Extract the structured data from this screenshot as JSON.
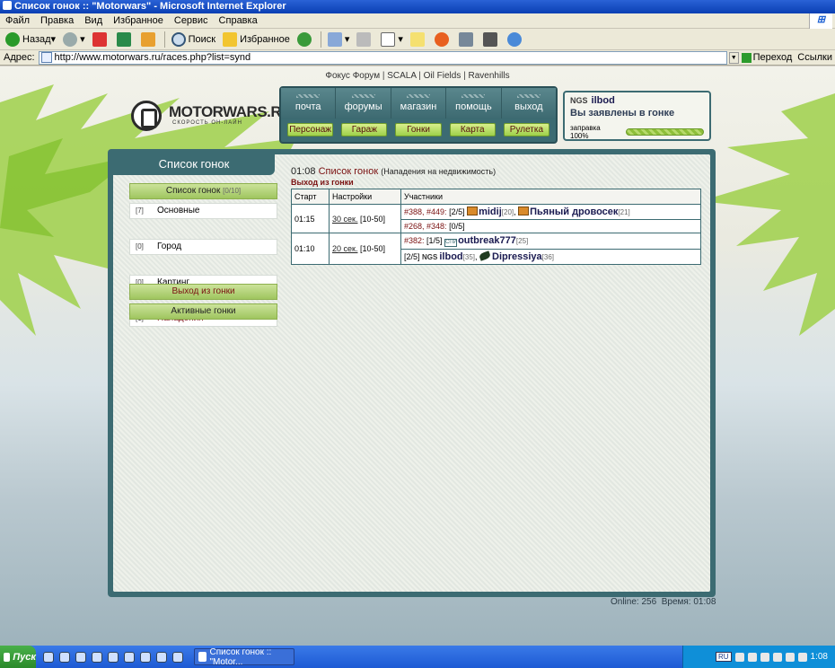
{
  "window": {
    "title": "Список гонок :: \"Motorwars\" - Microsoft Internet Explorer"
  },
  "menu": [
    "Файл",
    "Правка",
    "Вид",
    "Избранное",
    "Сервис",
    "Справка"
  ],
  "toolbar": {
    "back": "Назад",
    "search": "Поиск",
    "favorites": "Избранное"
  },
  "address": {
    "label": "Адрес:",
    "url": "http://www.motorwars.ru/races.php?list=synd",
    "go": "Переход",
    "links": "Ссылки"
  },
  "toplinks": [
    "Фокус Форум",
    "SCALA",
    "Oil Fields",
    "Ravenhills"
  ],
  "logo": {
    "name": "MOTORWARS.RU",
    "tagline": "СКОРОСТЬ ОН-ЛАЙН"
  },
  "nav_top": [
    "почта",
    "форумы",
    "магазин",
    "помощь",
    "выход"
  ],
  "nav_bottom": [
    "Персонаж",
    "Гараж",
    "Гонки",
    "Карта",
    "Рулетка"
  ],
  "user": {
    "tag": "NGS",
    "name": "ilbod",
    "status": "Вы заявлены в гонке",
    "fuel_label": "заправка 100%",
    "fuel_fraction": 1.0
  },
  "sidebar": {
    "title": "Список гонок",
    "list_label": "Список гонок",
    "list_count": "[0/10]",
    "items": [
      {
        "count": "[7]",
        "label": "Основные"
      },
      {
        "count": "[0]",
        "label": "Город"
      },
      {
        "count": "[0]",
        "label": "Картинг"
      },
      {
        "count": "[1]",
        "label": "Нападения"
      }
    ],
    "exit_label": "Выход из гонки",
    "active_label": "Активные гонки"
  },
  "content": {
    "time": "01:08",
    "title": "Список гонок",
    "subtitle": "(Нападения на недвижимость)",
    "exit_link": "Выход из гонки",
    "columns": [
      "Старт",
      "Настройки",
      "Участники"
    ],
    "races": [
      {
        "start": "01:15",
        "interval": "30 сек.",
        "range": "[10-50]",
        "line1": {
          "ids": "#388, #449:",
          "slots": "[2/5]",
          "p1": "midij",
          "p1lvl": "[20]",
          "p2": "Пьяный дровосек",
          "p2lvl": "[21]"
        },
        "line2": {
          "ids": "#268, #348:",
          "slots": "[0/5]"
        }
      },
      {
        "start": "01:10",
        "interval": "20 сек.",
        "range": "[10-50]",
        "line1": {
          "ids": "#382:",
          "slots": "[1/5]",
          "p1": "outbreak777",
          "p1lvl": "[25]"
        },
        "line2": {
          "slots": "[2/5]",
          "tag": "NGS",
          "p1": "ilbod",
          "p1lvl": "[35]",
          "p2": "Dipressiya",
          "p2lvl": "[36]"
        }
      }
    ]
  },
  "footer": {
    "online": "Online: 256",
    "time": "Время: 01:08"
  },
  "taskbar": {
    "start": "Пуск",
    "task": "Список гонок :: \"Motor...",
    "lang": "RU",
    "clock": "1:08"
  }
}
